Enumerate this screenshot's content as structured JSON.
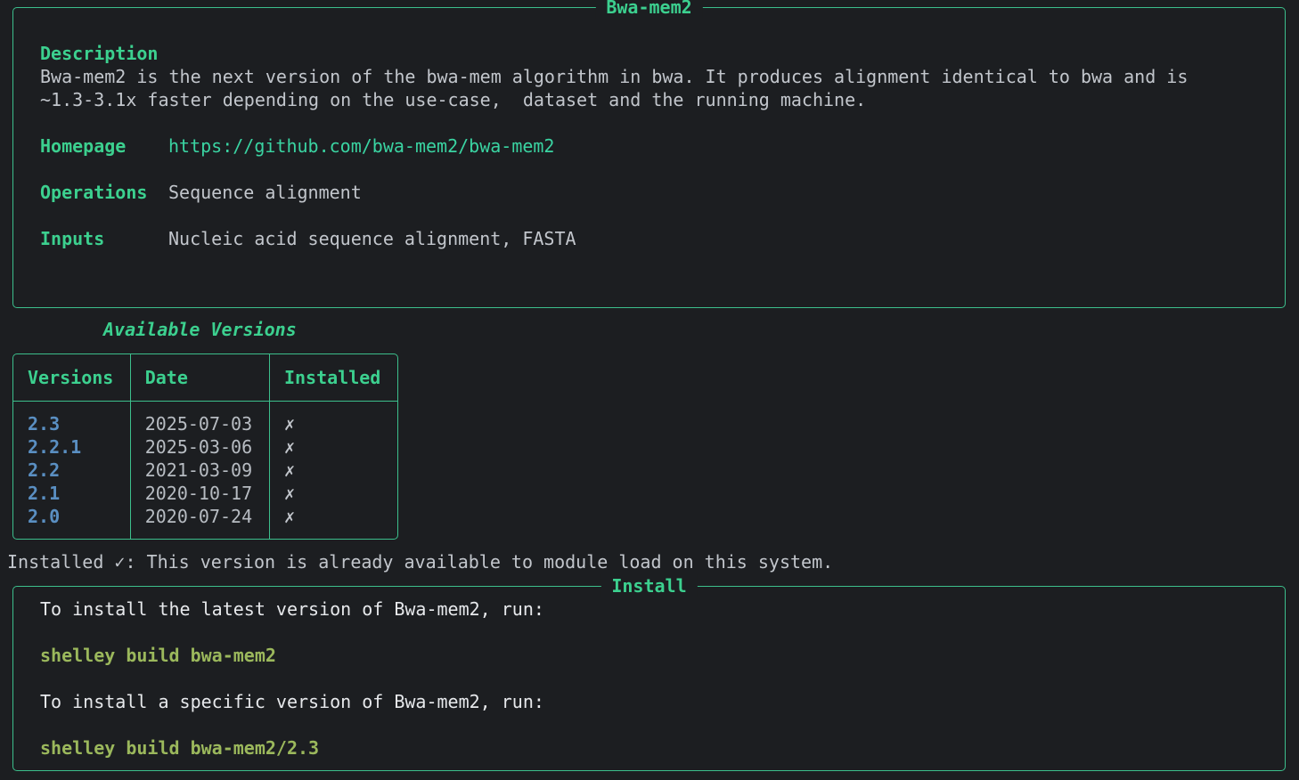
{
  "info_panel": {
    "title": "Bwa-mem2",
    "description_label": "Description",
    "description_line1": "Bwa-mem2 is the next version of the bwa-mem algorithm in bwa. It produces alignment identical to bwa and is",
    "description_line2": "~1.3-3.1x faster depending on the use-case,  dataset and the running machine.",
    "homepage_label": "Homepage",
    "homepage_value": "https://github.com/bwa-mem2/bwa-mem2",
    "operations_label": "Operations",
    "operations_value": "Sequence alignment",
    "inputs_label": "Inputs",
    "inputs_value": "Nucleic acid sequence alignment, FASTA"
  },
  "versions_table": {
    "caption": "Available Versions",
    "headers": [
      "Versions",
      "Date",
      "Installed"
    ],
    "rows": [
      {
        "version": "2.3",
        "date": "2025-07-03",
        "installed": "✗"
      },
      {
        "version": "2.2.1",
        "date": "2025-03-06",
        "installed": "✗"
      },
      {
        "version": "2.2",
        "date": "2021-03-09",
        "installed": "✗"
      },
      {
        "version": "2.1",
        "date": "2020-10-17",
        "installed": "✗"
      },
      {
        "version": "2.0",
        "date": "2020-07-24",
        "installed": "✗"
      }
    ]
  },
  "installed_note": "Installed ✓: This version is already available to module load on this system.",
  "install_panel": {
    "title": "Install",
    "latest_text": "To install the latest version of Bwa-mem2, run:",
    "latest_cmd": "shelley build bwa-mem2",
    "specific_text": "To install a specific version of Bwa-mem2, run:",
    "specific_cmd": "shelley build bwa-mem2/2.3"
  },
  "colors": {
    "background": "#1c1e21",
    "accent_green": "#3cd08f",
    "version_blue": "#5a8fc2",
    "command_green": "#9bb85c"
  }
}
